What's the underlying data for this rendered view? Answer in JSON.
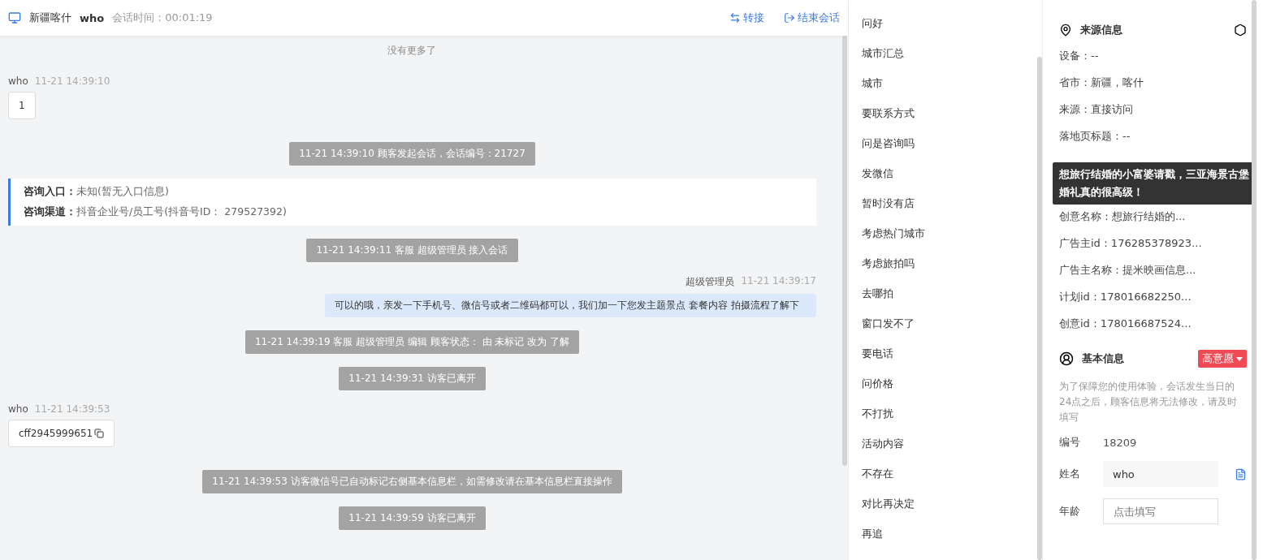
{
  "header": {
    "location": "新疆喀什",
    "visitor": "who",
    "session_label": "会话时间：",
    "session_time": "00:01:19",
    "actions": [
      {
        "kind": "transfer",
        "label": "转接"
      },
      {
        "kind": "end",
        "label": "结束会话"
      }
    ]
  },
  "chat": {
    "no_more": "没有更多了",
    "messages": [
      {
        "kind": "visitor",
        "sender": "who",
        "time": "11-21 14:39:10",
        "text": "1",
        "copyable": false
      },
      {
        "kind": "system",
        "text": "11-21 14:39:10 顾客发起会话，会话编号：21727"
      },
      {
        "kind": "entry",
        "lines": [
          {
            "label": "咨询入口：",
            "value": "未知(暂无入口信息)"
          },
          {
            "label": "咨询渠道：",
            "value": "抖音企业号/员工号(抖音号ID： 279527392)"
          }
        ]
      },
      {
        "kind": "system",
        "text": "11-21 14:39:11 客服 超级管理员 接入会话"
      },
      {
        "kind": "agent",
        "sender": "超级管理员",
        "time": "11-21 14:39:17",
        "text": "可以的哦，亲发一下手机号、微信号或者二维码都可以，我们加一下您发主题景点 套餐内容 拍摄流程了解下"
      },
      {
        "kind": "system",
        "text": "11-21 14:39:19 客服 超级管理员 编辑 顾客状态： 由 未标记 改为 了解"
      },
      {
        "kind": "system",
        "text": "11-21 14:39:31 访客已离开"
      },
      {
        "kind": "visitor",
        "sender": "who",
        "time": "11-21 14:39:53",
        "text": "cff2945999651",
        "copyable": true
      },
      {
        "kind": "system",
        "text": "11-21 14:39:53 访客微信号已自动标记右侧基本信息栏，如需修改请在基本信息栏直接操作"
      },
      {
        "kind": "system",
        "text": "11-21 14:39:59 访客已离开"
      }
    ]
  },
  "quick_replies": [
    "问好",
    "城市汇总",
    "城市",
    "要联系方式",
    "问是咨询吗",
    "发微信",
    "暂时没有店",
    "考虑热门城市",
    "考虑旅拍吗",
    "去哪拍",
    "窗口发不了",
    "要电话",
    "问价格",
    "不打扰",
    "活动内容",
    "不存在",
    "对比再决定",
    "再追"
  ],
  "source_info": {
    "title": "来源信息",
    "rows": [
      "设备：--",
      "省市：新疆，喀什",
      "来源：直接访问",
      "落地页标题：--",
      "创意名称：想旅行结婚的...",
      "广告主id：176285378923...",
      "广告主名称：提米映画信息...",
      "计划id：178016682250...",
      "创意id：178016687524..."
    ],
    "tooltip": "想旅行结婚的小富婆请戳，三亚海景古堡婚礼真的很高级！"
  },
  "basic_info": {
    "title": "基本信息",
    "intent": "高意愿",
    "notice": "为了保障您的使用体验，会话发生当日的24点之后，顾客信息将无法修改，请及时填写",
    "fields": [
      {
        "kind": "static",
        "label": "编号",
        "value": "18209"
      },
      {
        "kind": "filled",
        "label": "姓名",
        "value": "who"
      },
      {
        "kind": "empty",
        "label": "年龄",
        "placeholder": "点击填写"
      }
    ]
  }
}
